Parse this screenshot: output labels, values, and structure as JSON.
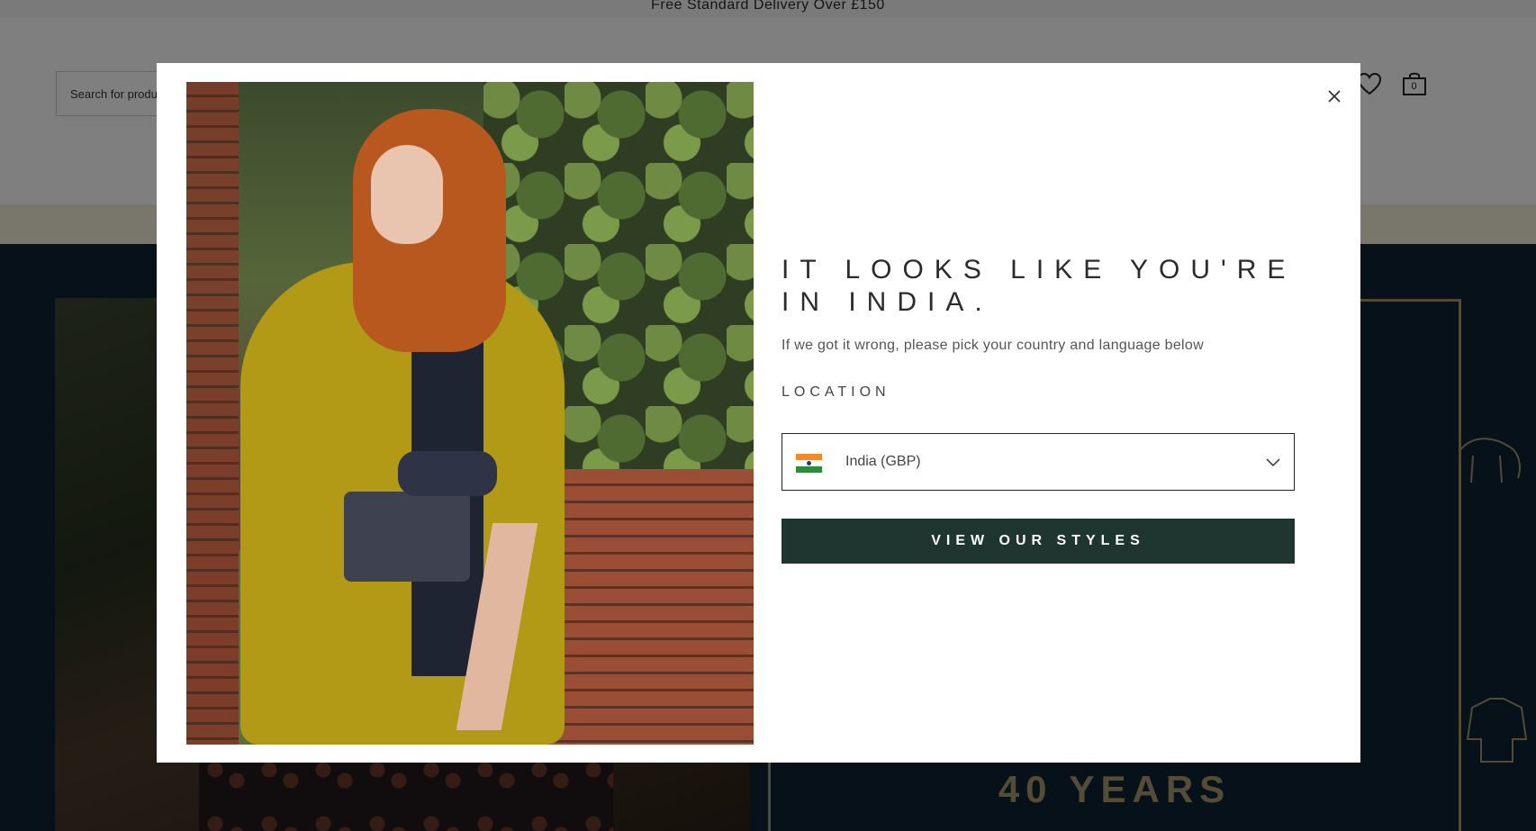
{
  "topbar": {
    "promo_text": "Free Standard Delivery Over £150"
  },
  "header": {
    "search_placeholder": "Search for products",
    "wishlist_icon": "heart-icon",
    "bag_icon": "shopping-bag-icon",
    "bag_count": "0"
  },
  "hero": {
    "title": "40 YEARS"
  },
  "modal": {
    "title_line1": "IT LOOKS LIKE YOU'RE",
    "title_line2": "IN INDIA.",
    "subtitle": "If we got it wrong, please pick your country and language below",
    "location_label": "LOCATION",
    "location_value": "India (GBP)",
    "location_flag": "india-flag-icon",
    "cta_label": "VIEW OUR STYLES",
    "close_icon": "close-icon",
    "colors": {
      "cta_bg": "#1f3530",
      "overlay": "rgba(0,0,0,0.5)"
    }
  }
}
